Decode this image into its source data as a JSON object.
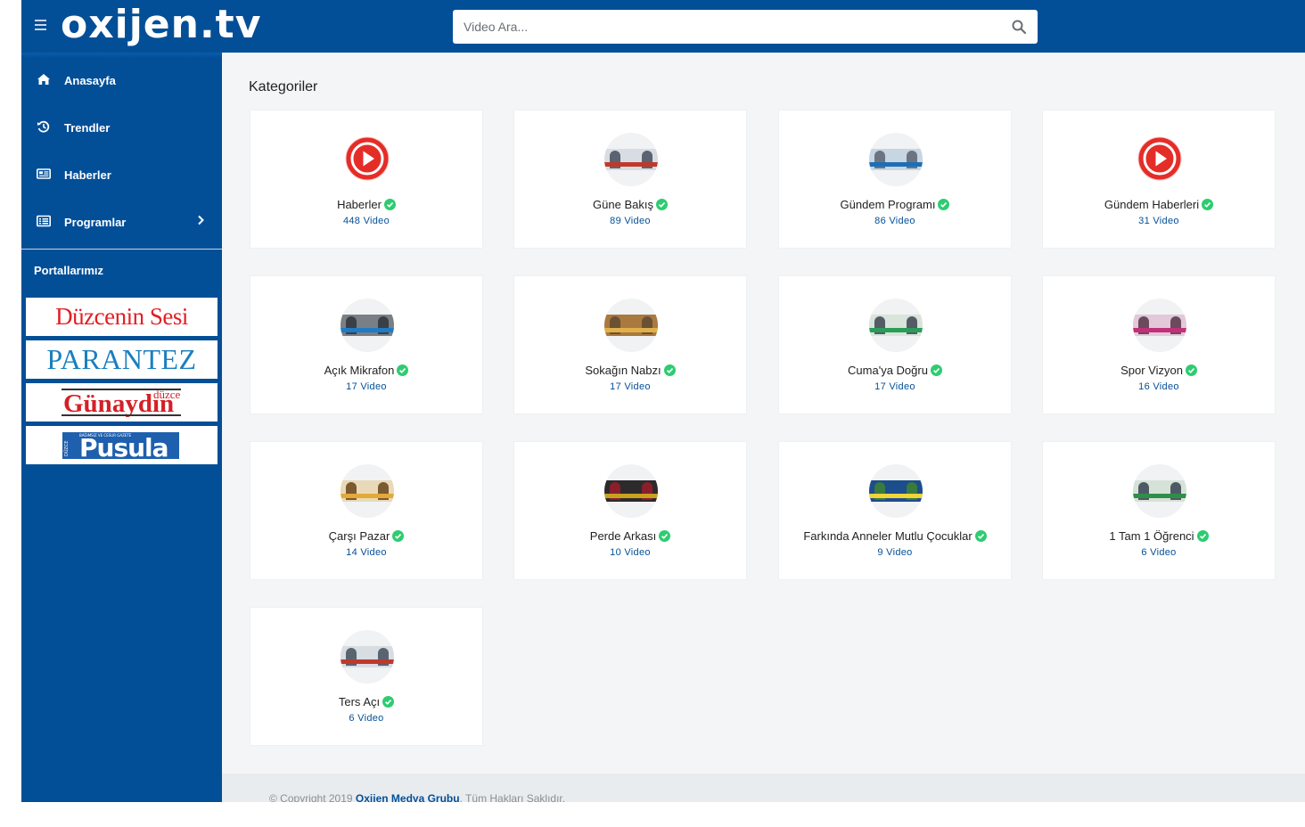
{
  "header": {
    "logo": "oxijen.tv",
    "search_placeholder": "Video Ara..."
  },
  "sidebar": {
    "items": [
      {
        "label": "Anasayfa",
        "icon": "home-icon"
      },
      {
        "label": "Trendler",
        "icon": "history-icon"
      },
      {
        "label": "Haberler",
        "icon": "newspaper-icon"
      },
      {
        "label": "Programlar",
        "icon": "list-icon",
        "has_submenu": true
      }
    ],
    "portals_title": "Portallarımız",
    "portals": [
      {
        "name": "Düzcenin Sesi"
      },
      {
        "name": "PARANTEZ"
      },
      {
        "name": "Günaydın",
        "sup": "düzce"
      },
      {
        "name": "Pusula",
        "side": "DÜZCE",
        "tag": "BAĞIMSIZ VE CESUR GAZETE"
      }
    ]
  },
  "main": {
    "title": "Kategoriler",
    "categories": [
      {
        "name": "Haberler",
        "count": "448 Video",
        "thumb": "play-icon"
      },
      {
        "name": "Güne Bakış",
        "count": "89 Video",
        "thumb": "program-banner"
      },
      {
        "name": "Gündem Programı",
        "count": "86 Video",
        "thumb": "program-banner"
      },
      {
        "name": "Gündem Haberleri",
        "count": "31 Video",
        "thumb": "play-icon"
      },
      {
        "name": "Açık Mikrafon",
        "count": "17 Video",
        "thumb": "program-banner"
      },
      {
        "name": "Sokağın Nabzı",
        "count": "17 Video",
        "thumb": "program-banner"
      },
      {
        "name": "Cuma'ya Doğru",
        "count": "17 Video",
        "thumb": "program-banner"
      },
      {
        "name": "Spor Vizyon",
        "count": "16 Video",
        "thumb": "program-banner"
      },
      {
        "name": "Çarşı Pazar",
        "count": "14 Video",
        "thumb": "program-banner"
      },
      {
        "name": "Perde Arkası",
        "count": "10 Video",
        "thumb": "program-banner"
      },
      {
        "name": "Farkında Anneler Mutlu Çocuklar",
        "count": "9 Video",
        "thumb": "program-banner"
      },
      {
        "name": "1 Tam 1 Öğrenci",
        "count": "6 Video",
        "thumb": "program-banner"
      },
      {
        "name": "Ters Açı",
        "count": "6 Video",
        "thumb": "program-banner"
      }
    ]
  },
  "footer": {
    "prefix": "© Copyright 2019",
    "link": "Oxijen Medya Grubu",
    "suffix": ". Tüm Hakları Saklıdır."
  },
  "colors": {
    "brand_blue": "#034f97",
    "verified_green": "#2ecc71",
    "play_red": "#e52d27"
  }
}
